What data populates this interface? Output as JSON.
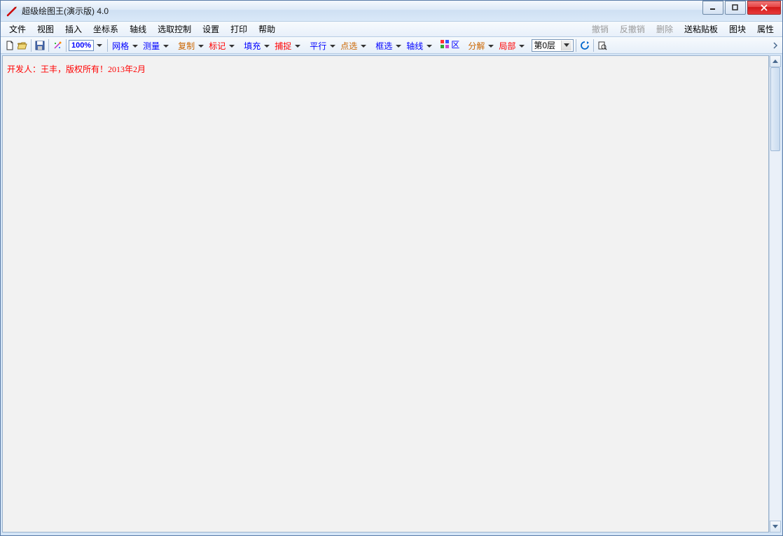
{
  "window": {
    "title": "超级绘图王(演示版) 4.0"
  },
  "menu": {
    "left": [
      "文件",
      "视图",
      "插入",
      "坐标系",
      "轴线",
      "选取控制",
      "设置",
      "打印",
      "帮助"
    ],
    "right_disabled": [
      "撤销",
      "反撤销",
      "删除"
    ],
    "right_enabled": [
      "送粘贴板",
      "图块",
      "属性"
    ]
  },
  "toolbar": {
    "zoom": "100%",
    "dropdowns": [
      {
        "label": "网格",
        "cls": "c-blue"
      },
      {
        "label": "测量",
        "cls": "c-blue"
      },
      {
        "label": "复制",
        "cls": "c-darkorange"
      },
      {
        "label": "标记",
        "cls": "c-red"
      },
      {
        "label": "填充",
        "cls": "c-blue"
      },
      {
        "label": "捕捉",
        "cls": "c-red"
      },
      {
        "label": "平行",
        "cls": "c-blue"
      },
      {
        "label": "点选",
        "cls": "c-darkorange"
      },
      {
        "label": "框选",
        "cls": "c-blue"
      },
      {
        "label": "轴线",
        "cls": "c-blue"
      },
      {
        "label": "分解",
        "cls": "c-darkorange"
      },
      {
        "label": "局部",
        "cls": "c-red"
      }
    ],
    "quzone_label": "区",
    "layer_value": "第0层"
  },
  "canvas": {
    "copyright_text": "开发人：王丰，版权所有！2013年2月"
  }
}
